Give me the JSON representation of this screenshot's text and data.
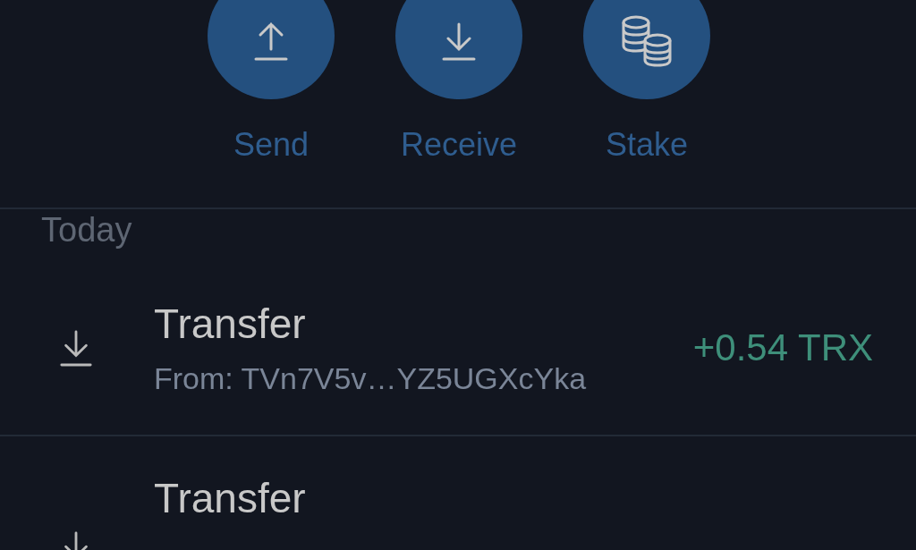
{
  "actions": [
    {
      "kind": "send",
      "label": "Send"
    },
    {
      "kind": "receive",
      "label": "Receive"
    },
    {
      "kind": "stake",
      "label": "Stake"
    }
  ],
  "section": "Today",
  "transactions": [
    {
      "kind": "in",
      "title": "Transfer",
      "subtitle": "From: TVn7V5v…YZ5UGXcYka",
      "amount": "+0.54 TRX"
    },
    {
      "kind": "in",
      "title": "Transfer"
    }
  ]
}
